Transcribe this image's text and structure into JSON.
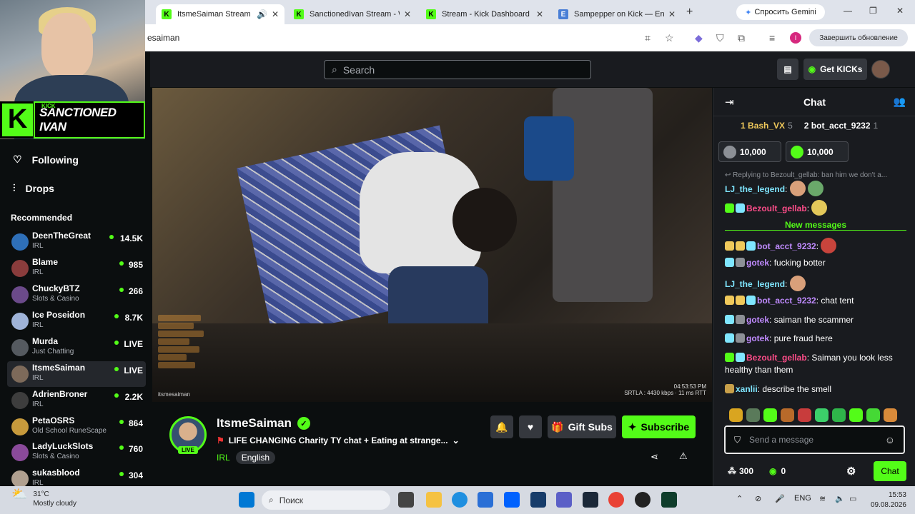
{
  "browser": {
    "tabs": [
      {
        "label": "ItsmeSaiman Stream - W",
        "favicon": "kick-icon",
        "active": true
      },
      {
        "label": "SanctionedIvan Stream - Wa",
        "favicon": "kick-icon",
        "active": false
      },
      {
        "label": "Stream - Kick Dashboard",
        "favicon": "kick-icon",
        "active": false
      },
      {
        "label": "Sampepper on Kick — Enga",
        "favicon": "engage-icon",
        "active": false
      }
    ],
    "new_tab": "+",
    "gemini_label": "Спросить Gemini",
    "url": "esaiman",
    "update_label": "Завершить обновление",
    "profile_initial": "I",
    "accent_color": "#53fc18"
  },
  "webcam": {
    "kick_text": "KICK",
    "logo_letter": "K",
    "name": "SANCTIONED IVAN"
  },
  "sidebar": {
    "following": "Following",
    "drops": "Drops",
    "recommended_title": "Recommended",
    "items": [
      {
        "name": "DeenTheGreat",
        "category": "IRL",
        "viewers": "14.5K",
        "avatar_color": "#2e6fb8"
      },
      {
        "name": "Blame",
        "category": "IRL",
        "viewers": "985",
        "avatar_color": "#8a3c3c"
      },
      {
        "name": "ChuckyBTZ",
        "category": "Slots & Casino",
        "viewers": "266",
        "avatar_color": "#6b4a8a"
      },
      {
        "name": "Ice Poseidon",
        "category": "IRL",
        "viewers": "8.7K",
        "avatar_color": "#9fb3d8"
      },
      {
        "name": "Murda",
        "category": "Just Chatting",
        "viewers": "LIVE",
        "avatar_color": "#555a60"
      },
      {
        "name": "ItsmeSaiman",
        "category": "IRL",
        "viewers": "LIVE",
        "avatar_color": "#7d6a5a",
        "selected": true
      },
      {
        "name": "AdrienBroner",
        "category": "IRL",
        "viewers": "2.2K",
        "avatar_color": "#3d3d3d"
      },
      {
        "name": "PetaOSRS",
        "category": "Old School RuneScape",
        "viewers": "864",
        "avatar_color": "#c79a3c"
      },
      {
        "name": "LadyLuckSlots",
        "category": "Slots & Casino",
        "viewers": "760",
        "avatar_color": "#8a4a9a"
      },
      {
        "name": "sukasblood",
        "category": "IRL",
        "viewers": "304",
        "avatar_color": "#b0a090"
      }
    ]
  },
  "topbar": {
    "search_placeholder": "Search",
    "get_kicks": "Get KICKs"
  },
  "video": {
    "watermark": "itsmesaiman",
    "timestamp": "04:53:53 PM",
    "stats": "SRTLA : 4430 kbps · 11 ms RTT"
  },
  "stream": {
    "channel_name": "ItsmeSaiman",
    "live_badge": "LIVE",
    "title": "LIFE CHANGING Charity TY chat + Eating at strange...",
    "category": "IRL",
    "language": "English",
    "gift_subs": "Gift Subs",
    "subscribe": "Subscribe"
  },
  "chat": {
    "header": "Chat",
    "leaders": [
      {
        "rank": "1",
        "name": "Bash_VX",
        "count": "5"
      },
      {
        "rank": "2",
        "name": "bot_acct_9232",
        "count": "1"
      }
    ],
    "gifts": [
      "10,000",
      "10,000"
    ],
    "reply_context": "Replying to Bezoult_gellab: ban him we don't a...",
    "new_messages": "New messages",
    "messages": [
      {
        "user": "LJ_the_legend",
        "text": "",
        "user_color": "#7fe6ff"
      },
      {
        "user": "Bezoult_gellab",
        "text": "",
        "user_color": "#ff4d8a"
      },
      {
        "user": "bot_acct_9232",
        "text": "",
        "user_color": "#c08bff"
      },
      {
        "user": "gotek",
        "text": "fucking botter",
        "user_color": "#c08bff"
      },
      {
        "user": "LJ_the_legend",
        "text": "",
        "user_color": "#7fe6ff"
      },
      {
        "user": "bot_acct_9232",
        "text": "chat tent",
        "user_color": "#c08bff"
      },
      {
        "user": "gotek",
        "text": "saiman the scammer",
        "user_color": "#c08bff"
      },
      {
        "user": "gotek",
        "text": "pure fraud here",
        "user_color": "#c08bff"
      },
      {
        "user": "Bezoult_gellab",
        "text": "Saiman you look less healthy than them",
        "user_color": "#ff4d8a"
      },
      {
        "user": "xanlii",
        "text": "describe the smell",
        "user_color": "#7fe6ff"
      }
    ],
    "input_placeholder": "Send a message",
    "points": "300",
    "kicks": "0",
    "send_label": "Chat"
  },
  "taskbar": {
    "temperature": "31°C",
    "weather": "Mostly cloudy",
    "search_label": "Поиск",
    "language": "ENG",
    "time": "15:53",
    "date": "09.08.2026"
  }
}
